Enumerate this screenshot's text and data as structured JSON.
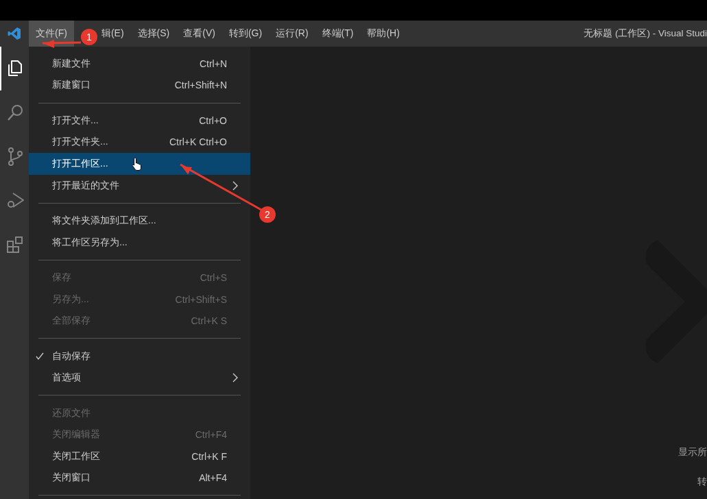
{
  "title_bar": {
    "menus": [
      {
        "label": "文件(F)",
        "selected": true
      },
      {
        "label": "辑(E)",
        "selected": false
      },
      {
        "label": "选择(S)",
        "selected": false
      },
      {
        "label": "查看(V)",
        "selected": false
      },
      {
        "label": "转到(G)",
        "selected": false
      },
      {
        "label": "运行(R)",
        "selected": false
      },
      {
        "label": "终端(T)",
        "selected": false
      },
      {
        "label": "帮助(H)",
        "selected": false
      }
    ],
    "title": "无标题 (工作区) - Visual Studi"
  },
  "activity_bar": [
    {
      "kind": "files",
      "selected": true
    },
    {
      "kind": "search",
      "selected": false
    },
    {
      "kind": "source-control",
      "selected": false
    },
    {
      "kind": "debug",
      "selected": false
    },
    {
      "kind": "extensions",
      "selected": false
    }
  ],
  "file_menu": [
    {
      "kind": "item",
      "label": "新建文件",
      "shortcut": "Ctrl+N",
      "disabled": false,
      "checked": false,
      "selected": false
    },
    {
      "kind": "item",
      "label": "新建窗口",
      "shortcut": "Ctrl+Shift+N",
      "disabled": false,
      "checked": false,
      "selected": false
    },
    {
      "kind": "separator"
    },
    {
      "kind": "item",
      "label": "打开文件...",
      "shortcut": "Ctrl+O",
      "disabled": false,
      "checked": false,
      "selected": false
    },
    {
      "kind": "item",
      "label": "打开文件夹...",
      "shortcut": "Ctrl+K Ctrl+O",
      "disabled": false,
      "checked": false,
      "selected": false
    },
    {
      "kind": "item",
      "label": "打开工作区...",
      "disabled": false,
      "checked": false,
      "selected": true
    },
    {
      "kind": "submenu",
      "label": "打开最近的文件",
      "disabled": false,
      "checked": false,
      "selected": false
    },
    {
      "kind": "separator"
    },
    {
      "kind": "item",
      "label": "将文件夹添加到工作区...",
      "disabled": false,
      "checked": false,
      "selected": false
    },
    {
      "kind": "item",
      "label": "将工作区另存为...",
      "disabled": false,
      "checked": false,
      "selected": false
    },
    {
      "kind": "separator"
    },
    {
      "kind": "item",
      "label": "保存",
      "shortcut": "Ctrl+S",
      "disabled": true,
      "checked": false,
      "selected": false
    },
    {
      "kind": "item",
      "label": "另存为...",
      "shortcut": "Ctrl+Shift+S",
      "disabled": true,
      "checked": false,
      "selected": false
    },
    {
      "kind": "item",
      "label": "全部保存",
      "shortcut": "Ctrl+K S",
      "disabled": true,
      "checked": false,
      "selected": false
    },
    {
      "kind": "separator"
    },
    {
      "kind": "item",
      "label": "自动保存",
      "disabled": false,
      "checked": true,
      "selected": false
    },
    {
      "kind": "submenu",
      "label": "首选项",
      "disabled": false,
      "checked": false,
      "selected": false
    },
    {
      "kind": "separator"
    },
    {
      "kind": "item",
      "label": "还原文件",
      "disabled": true,
      "checked": false,
      "selected": false
    },
    {
      "kind": "item",
      "label": "关闭编辑器",
      "shortcut": "Ctrl+F4",
      "disabled": true,
      "checked": false,
      "selected": false
    },
    {
      "kind": "item",
      "label": "关闭工作区",
      "shortcut": "Ctrl+K F",
      "disabled": false,
      "checked": false,
      "selected": false
    },
    {
      "kind": "item",
      "label": "关闭窗口",
      "shortcut": "Alt+F4",
      "disabled": false,
      "checked": false,
      "selected": false
    },
    {
      "kind": "separator"
    }
  ],
  "editor": {
    "hints": [
      "显示所",
      "转"
    ]
  },
  "annotations": [
    {
      "number": "1"
    },
    {
      "number": "2"
    }
  ]
}
